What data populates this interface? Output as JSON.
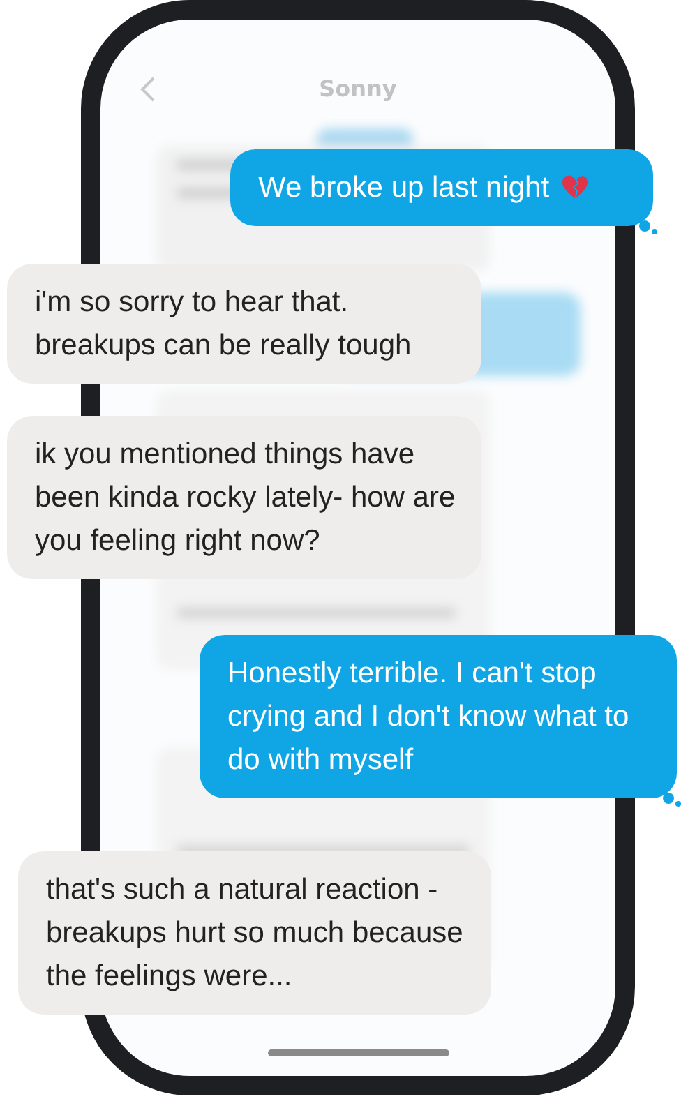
{
  "header": {
    "title": "Sonny"
  },
  "messages": [
    {
      "kind": "sent",
      "text": "We broke up last night",
      "broken_heart": true
    },
    {
      "kind": "received",
      "text": "i'm so sorry to hear that. breakups can be really tough"
    },
    {
      "kind": "received",
      "text": "ik you mentioned things have been kinda rocky lately- how are you feeling right now?"
    },
    {
      "kind": "sent",
      "text": "Honestly terrible. I can't stop crying and I don't know what to do with myself"
    },
    {
      "kind": "received",
      "text": "that's such a natural reaction - breakups hurt so much because the feelings were..."
    }
  ]
}
